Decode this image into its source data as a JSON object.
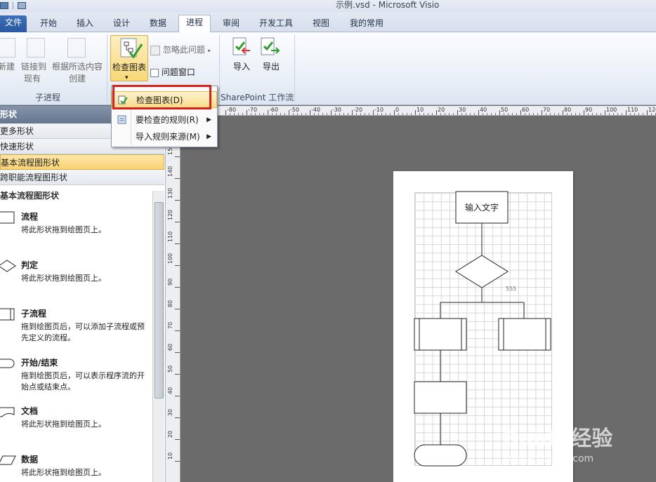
{
  "window": {
    "title": "示例.vsd - Microsoft Visio"
  },
  "tabs": [
    {
      "label": "文件"
    },
    {
      "label": "开始"
    },
    {
      "label": "插入"
    },
    {
      "label": "设计"
    },
    {
      "label": "数据"
    },
    {
      "label": "进程"
    },
    {
      "label": "审阅"
    },
    {
      "label": "开发工具"
    },
    {
      "label": "视图"
    },
    {
      "label": "我的常用"
    }
  ],
  "ribbon": {
    "subprocess": {
      "new": "新建",
      "link_line1": "链接到",
      "link_line2": "现有",
      "from_sel_line1": "根据所选内容",
      "from_sel_line2": "创建",
      "group": "子进程"
    },
    "validation": {
      "check_diagram": "检查图表",
      "ignore_issue": "忽略此问题",
      "issues_window": "问题窗口"
    },
    "sharepoint": {
      "import": "导入",
      "export": "导出",
      "group": "SharePoint 工作流"
    }
  },
  "dropdown": {
    "items": [
      {
        "label": "检查图表(D)",
        "submenu": false
      },
      {
        "label": "要检查的规则(R)",
        "submenu": true
      },
      {
        "label": "导入规则来源(M)",
        "submenu": true
      }
    ]
  },
  "shapes_pane": {
    "header": "形状",
    "stencils": [
      "更多形状",
      "快速形状",
      "基本流程图形状",
      "跨职能流程图形状"
    ],
    "active_stencil": "基本流程图形状",
    "stencil_title": "基本流程图形状",
    "shapes": [
      {
        "name": "流程",
        "desc": "将此形状拖到绘图页上。",
        "icon": "process-icon"
      },
      {
        "name": "判定",
        "desc": "将此形状拖到绘图页上。",
        "icon": "decision-icon"
      },
      {
        "name": "子流程",
        "desc": "拖到绘图页后，可以添加子流程或预先定义的流程。",
        "icon": "subprocess-icon"
      },
      {
        "name": "开始/结束",
        "desc": "拖到绘图页后，可以表示程序流的开始点或结束点。",
        "icon": "terminator-icon"
      },
      {
        "name": "文档",
        "desc": "将此形状拖到绘图页上。",
        "icon": "document-icon"
      },
      {
        "name": "数据",
        "desc": "将此形状拖到绘图页上。",
        "icon": "data-icon"
      }
    ]
  },
  "ruler": {
    "horizontal": [
      "-80",
      "-70",
      "-60",
      "-50",
      "-40",
      "-30",
      "-20",
      "-10",
      "0",
      "10",
      "20",
      "30",
      "40",
      "50",
      "60",
      "70",
      "80",
      "90",
      "100",
      "110",
      "120"
    ],
    "vertical": [
      "150",
      "140",
      "130",
      "120",
      "110",
      "100",
      "90",
      "80",
      "70",
      "60",
      "50",
      "40",
      "30",
      "20",
      "10"
    ]
  },
  "diagram": {
    "start_box_text": "输入文字",
    "decision_label": "555"
  },
  "watermark": {
    "main": "Baidu经验",
    "sub": "jingyan.baidu.com"
  },
  "colors": {
    "accent": "#2a58a3",
    "highlight": "#f8dd86",
    "callout": "#d4221d"
  }
}
